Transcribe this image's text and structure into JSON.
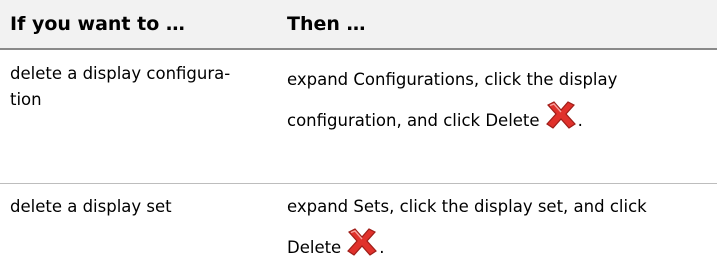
{
  "table": {
    "header": {
      "col1": "If you want to …",
      "col2": "Then …"
    },
    "rows": [
      {
        "col1_lines": [
          "delete a display configura-",
          "tion"
        ],
        "col2_lines": [
          "expand Configurations, click the display",
          "configuration, and click Delete"
        ],
        "trailing": "."
      },
      {
        "col1_lines": [
          "delete a display set"
        ],
        "col2_lines": [
          "expand Sets, click the display set, and click",
          "Delete"
        ],
        "trailing": "."
      }
    ]
  },
  "icons": {
    "delete": "delete-x-icon"
  },
  "colors": {
    "header_bg": "#f2f2f2",
    "delete_red": "#e0312b"
  }
}
